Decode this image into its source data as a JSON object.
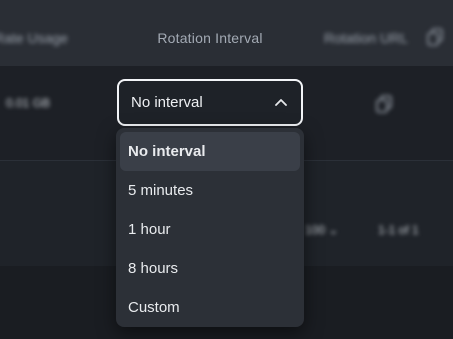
{
  "table": {
    "header": {
      "left_column": "Rate Usage",
      "rotation_interval": "Rotation Interval",
      "right_column": "Rotation URL"
    },
    "row": {
      "usage": "0.01 GB"
    },
    "footer": {
      "rows_per_page": "100",
      "pagination": "1-1 of 1"
    }
  },
  "select": {
    "value": "No interval",
    "options": [
      "No interval",
      "5 minutes",
      "1 hour",
      "8 hours",
      "Custom"
    ]
  },
  "icons": {
    "copy": "copy-icon",
    "chevron": "chevron-up-icon",
    "rpp_chevron": "chevron-down-icon"
  }
}
